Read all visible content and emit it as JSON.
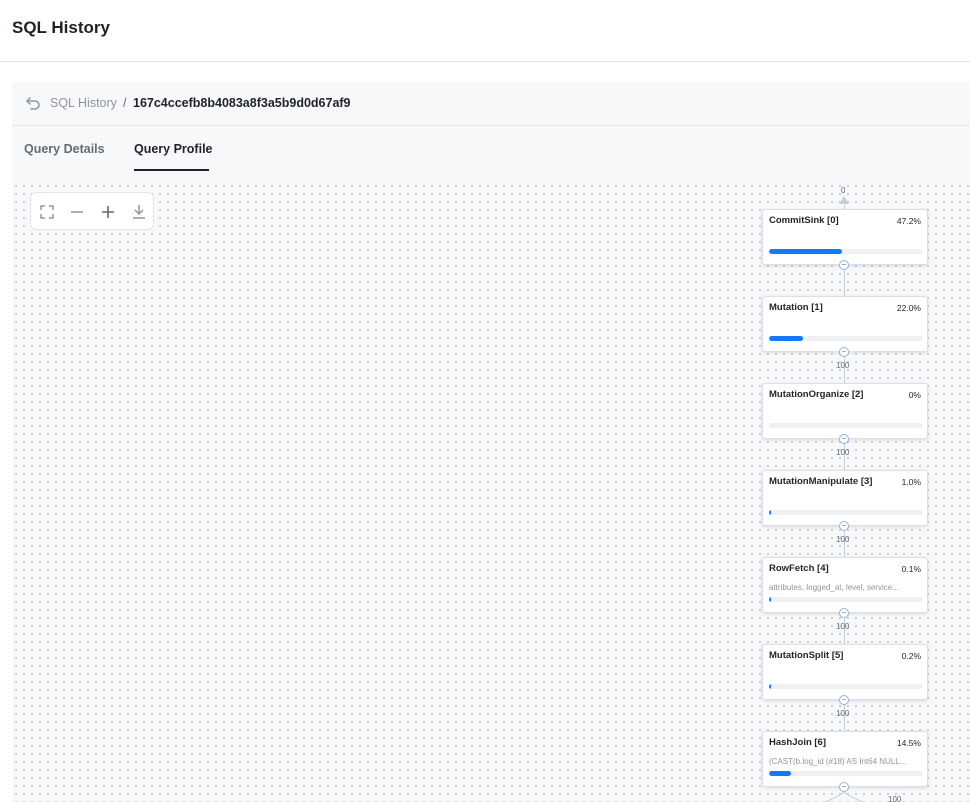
{
  "header": {
    "title": "SQL History"
  },
  "breadcrumb": {
    "link": "SQL History",
    "separator": "/",
    "current": "167c4ccefb8b4083a8f3a5b9d0d67af9"
  },
  "tabs": [
    {
      "label": "Query Details",
      "active": false
    },
    {
      "label": "Query Profile",
      "active": true
    }
  ],
  "toolbar": {
    "icons": [
      "fullscreen-icon",
      "zoom-out-icon",
      "zoom-in-icon",
      "download-icon"
    ]
  },
  "graph": {
    "top_label": "0",
    "nodes": [
      {
        "name": "CommitSink [0]",
        "percent": "47.2%",
        "fraction": 0.472,
        "detail": ""
      },
      {
        "name": "Mutation [1]",
        "percent": "22.0%",
        "fraction": 0.22,
        "detail": ""
      },
      {
        "name": "MutationOrganize [2]",
        "percent": "0%",
        "fraction": 0,
        "detail": ""
      },
      {
        "name": "MutationManipulate [3]",
        "percent": "1.0%",
        "fraction": 0.01,
        "detail": ""
      },
      {
        "name": "RowFetch [4]",
        "percent": "0.1%",
        "fraction": 0.001,
        "detail": "attributes, logged_at, level, service..."
      },
      {
        "name": "MutationSplit [5]",
        "percent": "0.2%",
        "fraction": 0.002,
        "detail": ""
      },
      {
        "name": "HashJoin [6]",
        "percent": "14.5%",
        "fraction": 0.145,
        "detail": "(CAST(b.log_id (#18) AS Int64 NULL..."
      }
    ],
    "edge_labels": [
      "100",
      "100",
      "100",
      "100",
      "100"
    ],
    "bottom_edge_label": "100"
  },
  "colors": {
    "accent": "#1677ff",
    "port": "#8fb3e6"
  }
}
